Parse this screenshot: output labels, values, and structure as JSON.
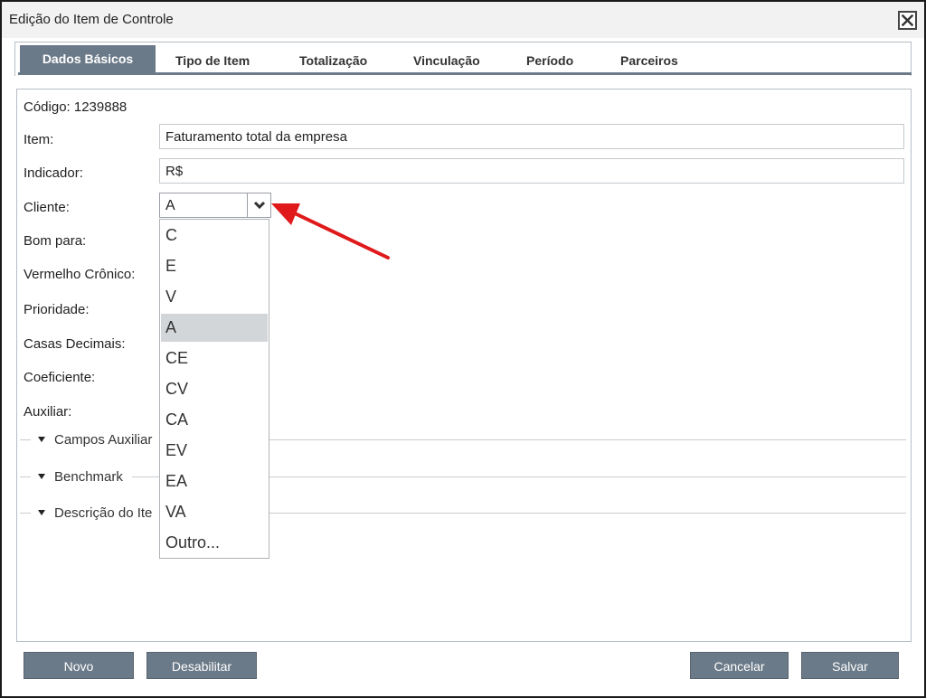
{
  "window": {
    "title": "Edição do Item de Controle"
  },
  "tabs": [
    {
      "label": "Dados Básicos"
    },
    {
      "label": "Tipo de Item"
    },
    {
      "label": "Totalização"
    },
    {
      "label": "Vinculação"
    },
    {
      "label": "Período"
    },
    {
      "label": "Parceiros"
    }
  ],
  "form": {
    "codigo": "Código: 1239888",
    "item_label": "Item:",
    "item_value": "Faturamento total da empresa",
    "indicador_label": "Indicador:",
    "indicador_value": "R$",
    "cliente_label": "Cliente:",
    "cliente_value": "A",
    "bom_para_label": "Bom para:",
    "vermelho_label": "Vermelho Crônico:",
    "prioridade_label": "Prioridade:",
    "casas_label": "Casas Decimais:",
    "coeficiente_label": "Coeficiente:",
    "auxiliar_label": "Auxiliar:"
  },
  "dropdown": {
    "options": [
      "C",
      "E",
      "V",
      "A",
      "CE",
      "CV",
      "CA",
      "EV",
      "EA",
      "VA",
      "Outro..."
    ],
    "selected": "A"
  },
  "sections": [
    {
      "label": "Campos Auxiliar"
    },
    {
      "label": "Benchmark"
    },
    {
      "label": "Descrição do Ite"
    }
  ],
  "footer": {
    "novo": "Novo",
    "desabilitar": "Desabilitar",
    "cancelar": "Cancelar",
    "salvar": "Salvar"
  },
  "colors": {
    "accent": "#6b7a88",
    "annotation_arrow": "#e0191b"
  },
  "icons": {
    "close": "close-icon",
    "dropdown": "chevron-down-icon",
    "section": "caret-down-icon"
  }
}
